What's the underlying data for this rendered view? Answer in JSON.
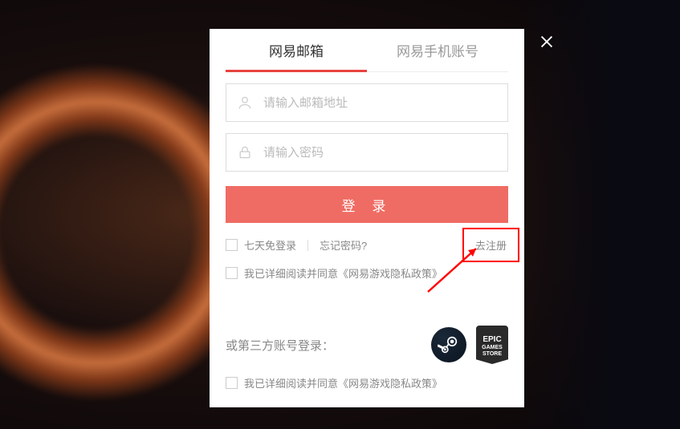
{
  "tabs": {
    "email": "网易邮箱",
    "phone": "网易手机账号"
  },
  "inputs": {
    "email_placeholder": "请输入邮箱地址",
    "password_placeholder": "请输入密码"
  },
  "buttons": {
    "login": "登 录"
  },
  "options": {
    "remember": "七天免登录",
    "forgot": "忘记密码?",
    "register": "去注册"
  },
  "agreement": {
    "prefix": "我已详细阅读并同意",
    "policy": "《网易游戏隐私政策》"
  },
  "third_party": {
    "label": "或第三方账号登录：",
    "epic_top": "EPIC",
    "epic_mid": "GAMES",
    "epic_bot": "STORE"
  }
}
